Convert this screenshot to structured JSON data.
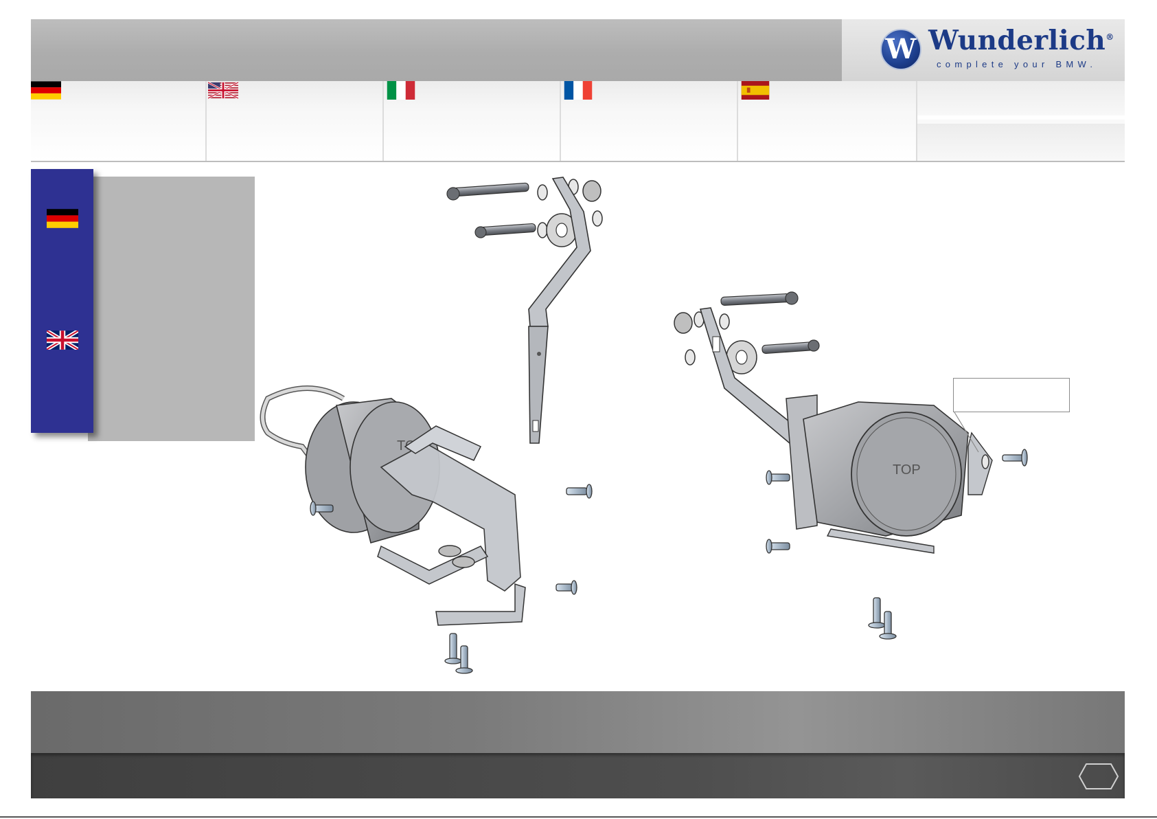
{
  "brand": {
    "name": "Wunderlich",
    "registered": "®",
    "tagline": "complete your BMW.",
    "logo_letter": "W",
    "colors": {
      "brand_blue": "#1c3a86",
      "panel_blue": "#2e3192"
    }
  },
  "languages": [
    {
      "code": "de",
      "flag": "flag-germany-icon"
    },
    {
      "code": "en-us",
      "flag": "flag-usa-icon"
    },
    {
      "code": "it",
      "flag": "flag-italy-icon"
    },
    {
      "code": "fr",
      "flag": "flag-france-icon"
    },
    {
      "code": "es",
      "flag": "flag-spain-icon"
    }
  ],
  "side_panel": {
    "flags": [
      "flag-germany-icon",
      "flag-uk-icon"
    ]
  },
  "diagram": {
    "left_assembly_label": "TOP",
    "right_assembly_label": "TOP",
    "callout_text": ""
  },
  "footer": {
    "next_icon": "hexagon-next-icon"
  }
}
